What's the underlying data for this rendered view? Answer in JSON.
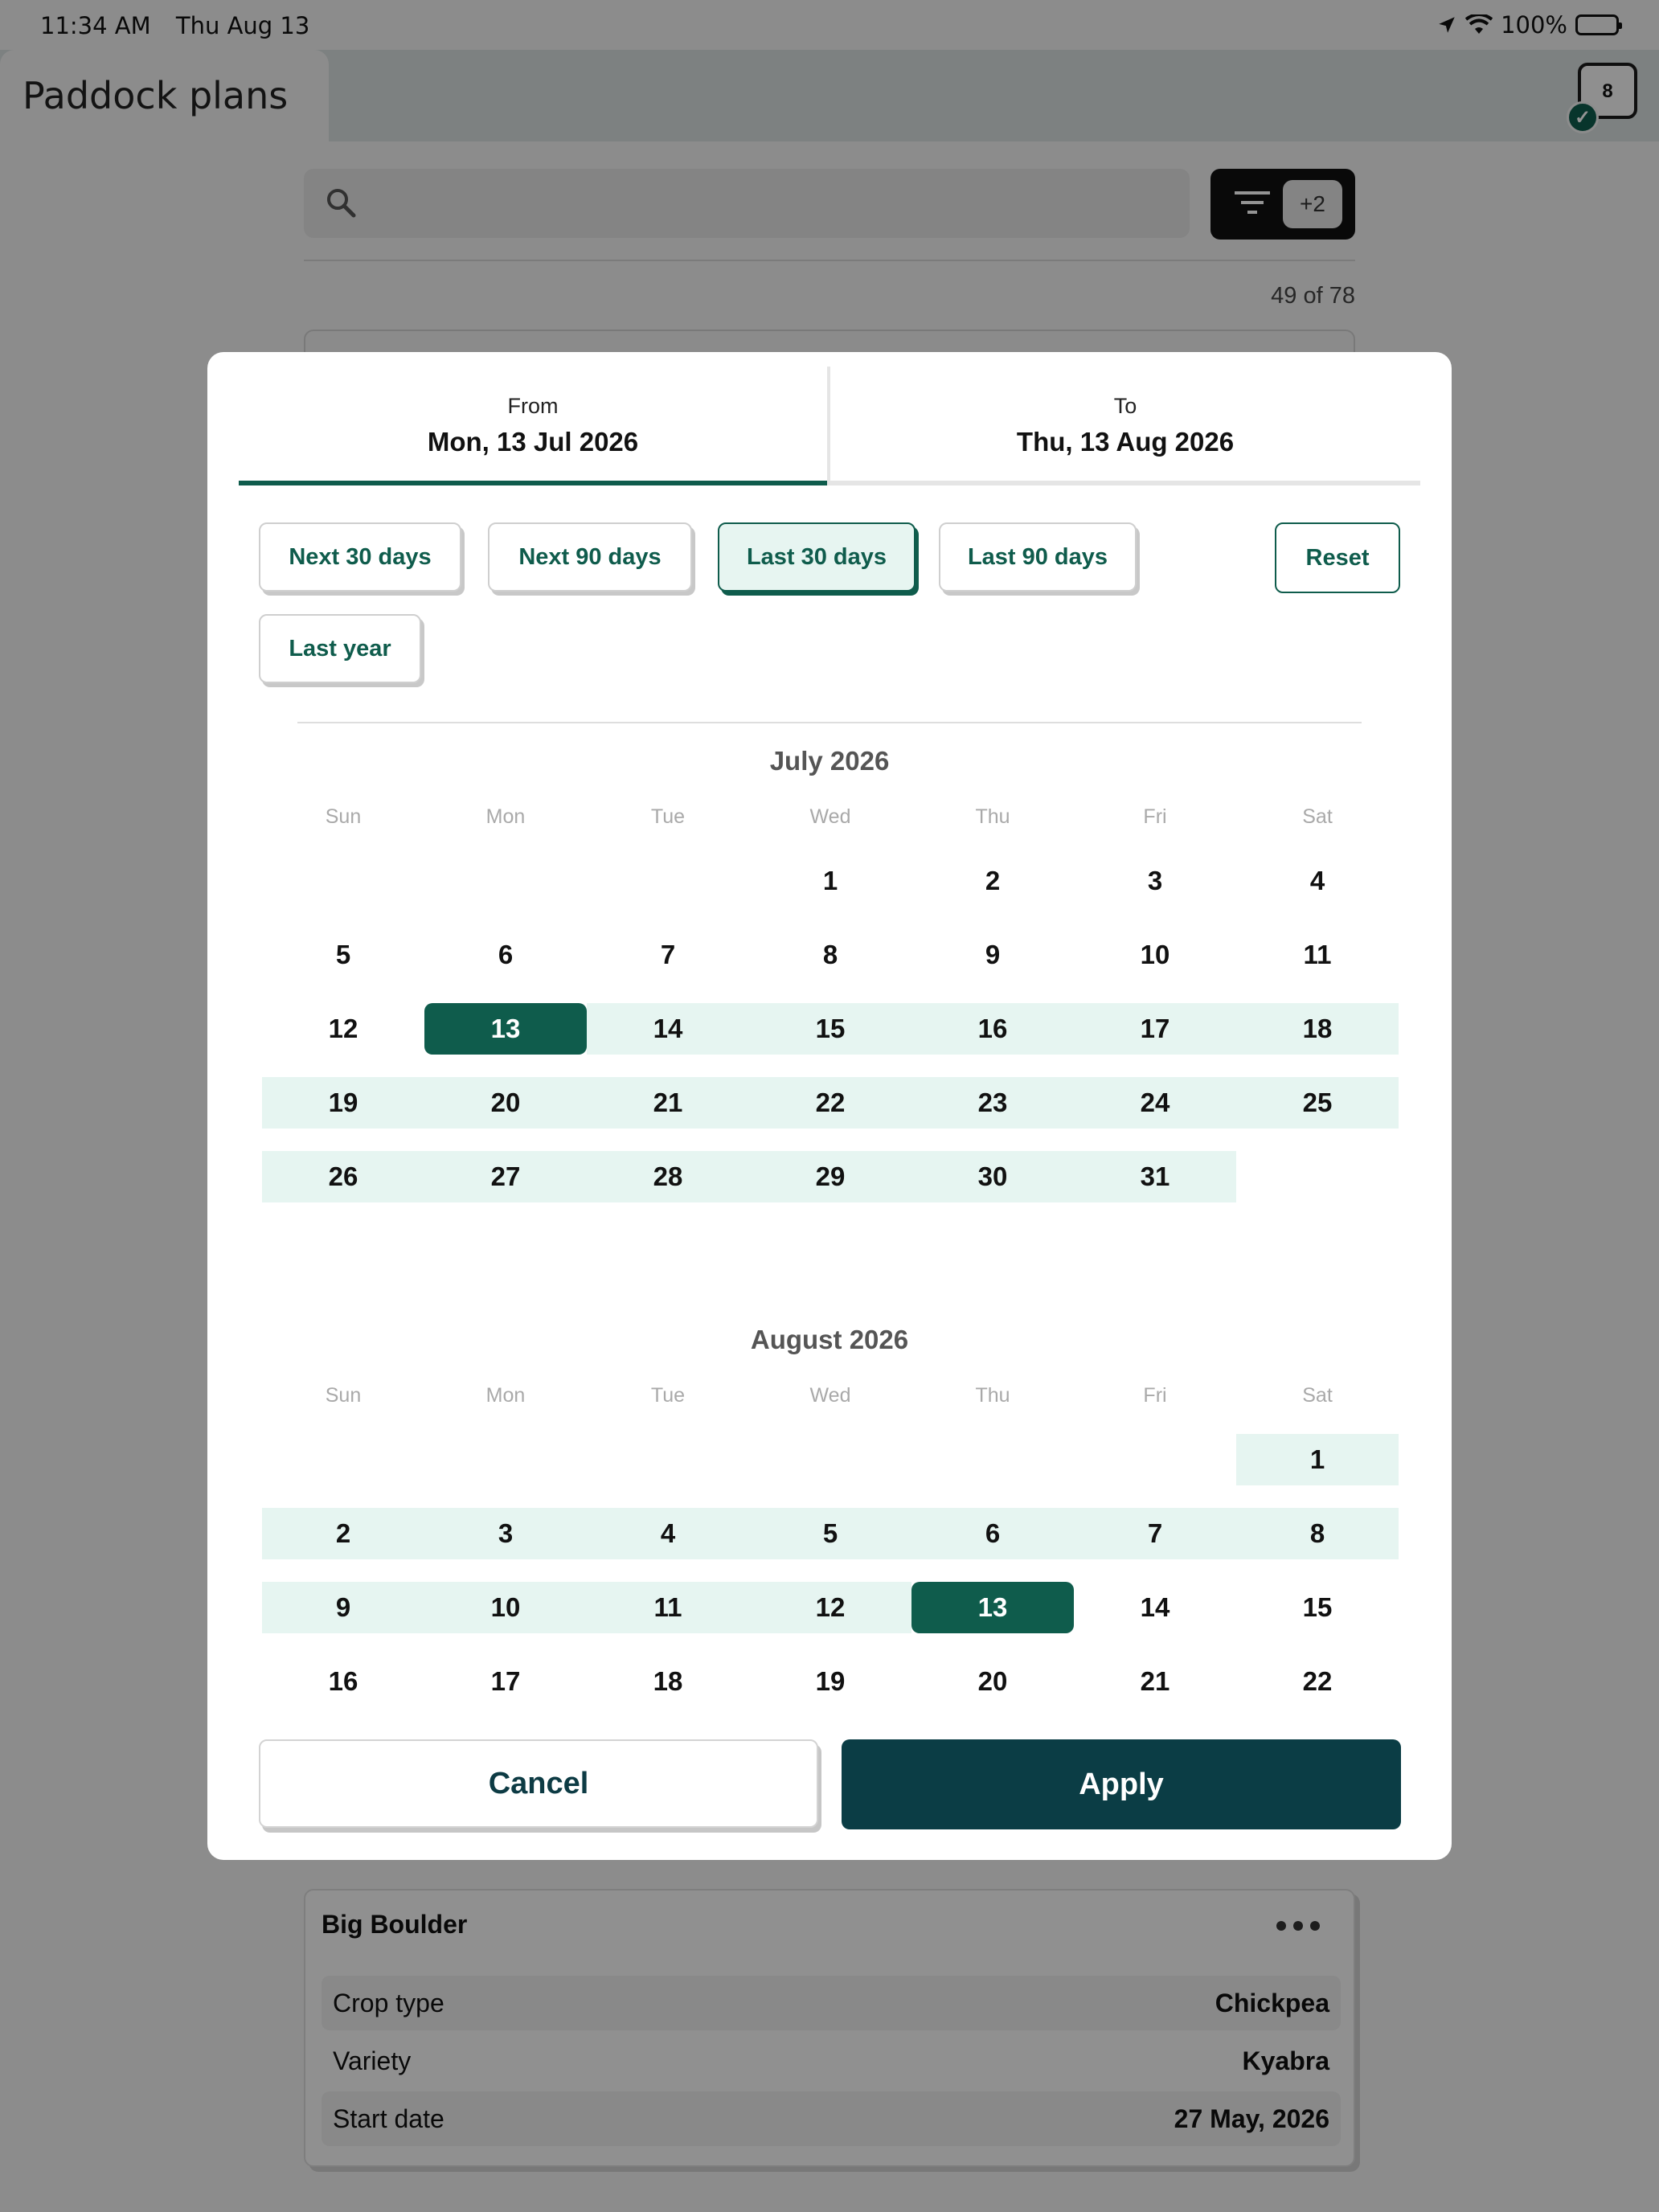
{
  "status_bar": {
    "time": "11:34 AM",
    "date": "Thu Aug 13",
    "battery": "100%"
  },
  "header": {
    "title": "Paddock plans",
    "sync_count": "8"
  },
  "search": {
    "placeholder": ""
  },
  "filter": {
    "badge": "+2"
  },
  "results": {
    "count": "49 of 78"
  },
  "plan_card": {
    "name": "Big Boulder",
    "rows": [
      {
        "label": "Crop type",
        "value": "Chickpea"
      },
      {
        "label": "Variety",
        "value": "Kyabra"
      },
      {
        "label": "Start date",
        "value": "27 May, 2026"
      }
    ]
  },
  "date_picker": {
    "from": {
      "label": "From",
      "value": "Mon, 13 Jul 2026"
    },
    "to": {
      "label": "To",
      "value": "Thu, 13 Aug 2026"
    },
    "quick_ranges": [
      {
        "label": "Next 30 days",
        "active": false
      },
      {
        "label": "Next 90 days",
        "active": false
      },
      {
        "label": "Last 30 days",
        "active": true
      },
      {
        "label": "Last 90 days",
        "active": false
      },
      {
        "label": "Last year",
        "active": false
      }
    ],
    "reset_label": "Reset",
    "weekdays": [
      "Sun",
      "Mon",
      "Tue",
      "Wed",
      "Thu",
      "Fri",
      "Sat"
    ],
    "months": [
      {
        "title": "July 2026",
        "first_weekday": 3,
        "days_in_month": 31,
        "range_start": 13,
        "range_end": 31,
        "selected": [
          13
        ]
      },
      {
        "title": "August 2026",
        "first_weekday": 6,
        "days_in_month": 22,
        "range_start": 1,
        "range_end": 13,
        "selected": [
          13
        ]
      }
    ],
    "cancel_label": "Cancel",
    "apply_label": "Apply"
  },
  "colors": {
    "accent": "#0f5c4c",
    "range": "#e6f5f1",
    "apply": "#0b3d45"
  },
  "icons": [
    "location-arrow-icon",
    "wifi-icon",
    "battery-icon",
    "check-icon",
    "search-icon",
    "filter-icon",
    "more-horizontal-icon"
  ]
}
